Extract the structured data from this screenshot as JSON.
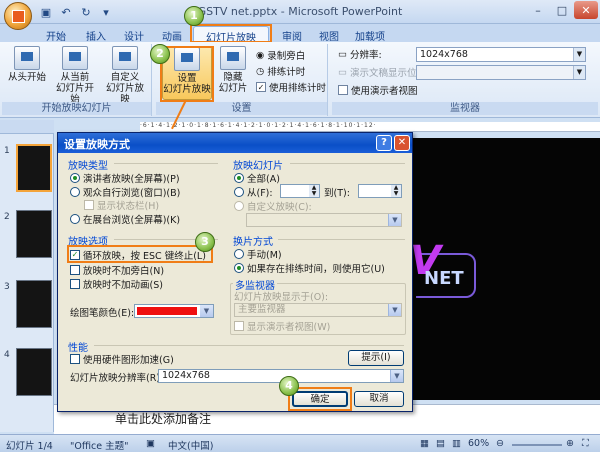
{
  "window": {
    "title": "GSTV net.pptx - Microsoft PowerPoint"
  },
  "qat": {
    "icons": [
      "save-icon",
      "undo-icon",
      "redo-icon"
    ]
  },
  "tabs": [
    "开始",
    "插入",
    "设计",
    "动画",
    "幻灯片放映",
    "审阅",
    "视图",
    "加载项"
  ],
  "active_tab": "幻灯片放映",
  "ribbon": {
    "start_group": {
      "label": "开始放映幻灯片",
      "from_start": "从头开始",
      "from_current": "从当前\n幻灯片开始",
      "custom": "自定义\n幻灯片放映"
    },
    "setup_group": {
      "label": "设置",
      "setup_show": "设置\n幻灯片放映",
      "hide_slide": "隐藏\n幻灯片",
      "record_narration": "录制旁白",
      "rehearse_timings": "排练计时",
      "use_timings": "使用排练计时"
    },
    "monitors_group": {
      "label": "监视器",
      "resolution_label": "分辨率:",
      "resolution_value": "1024x768",
      "show_on_label": "演示文稿显示位置:",
      "presenter_view": "使用演示者视图"
    }
  },
  "badges": [
    "1",
    "2",
    "3",
    "4"
  ],
  "slides": {
    "numbers": [
      "1",
      "2",
      "3",
      "4"
    ]
  },
  "ruler_text": "·6·1·4·1·2·1·0·1·8·1·6·1·4·1·2·1·0·1·2·1·4·1·6·1·8·1·10·1·12·",
  "slide_main": {
    "logo_letter": "V",
    "logo_text": "NET"
  },
  "notes_placeholder": "单击此处添加备注",
  "status": {
    "slide_index": "幻灯片 1/4",
    "theme": "\"Office 主题\"",
    "language": "中文(中国)",
    "zoom": "60%"
  },
  "dialog": {
    "title": "设置放映方式",
    "show_type": {
      "label": "放映类型",
      "presenter": "演讲者放映(全屏幕)(P)",
      "individual": "观众自行浏览(窗口)(B)",
      "show_scrollbar": "显示状态栏(H)",
      "kiosk": "在展台浏览(全屏幕)(K)"
    },
    "show_options": {
      "label": "放映选项",
      "loop": "循环放映，按 ESC 键终止(L)",
      "no_narration": "放映时不加旁白(N)",
      "no_animation": "放映时不加动画(S)",
      "pen_color": "绘图笔颜色(E):"
    },
    "show_slides": {
      "label": "放映幻灯片",
      "all": "全部(A)",
      "from": "从(F):",
      "to": "到(T):",
      "custom": "自定义放映(C):"
    },
    "advance": {
      "label": "换片方式",
      "manual": "手动(M)",
      "timings": "如果存在排练时间，则使用它(U)"
    },
    "multi_monitor": {
      "label": "多监视器",
      "display_on": "幻灯片放映显示于(O):",
      "primary": "主要监视器",
      "presenter_view": "显示演示者视图(W)"
    },
    "performance": {
      "label": "性能",
      "hw_accel": "使用硬件图形加速(G)",
      "tips": "提示(I)",
      "resolution_label": "幻灯片放映分辨率(R):",
      "resolution_value": "1024x768"
    },
    "ok": "确定",
    "cancel": "取消"
  },
  "colors": {
    "accent": "#f07d16",
    "pen": "#ef1010",
    "title_blue": "#0a4fc7"
  }
}
